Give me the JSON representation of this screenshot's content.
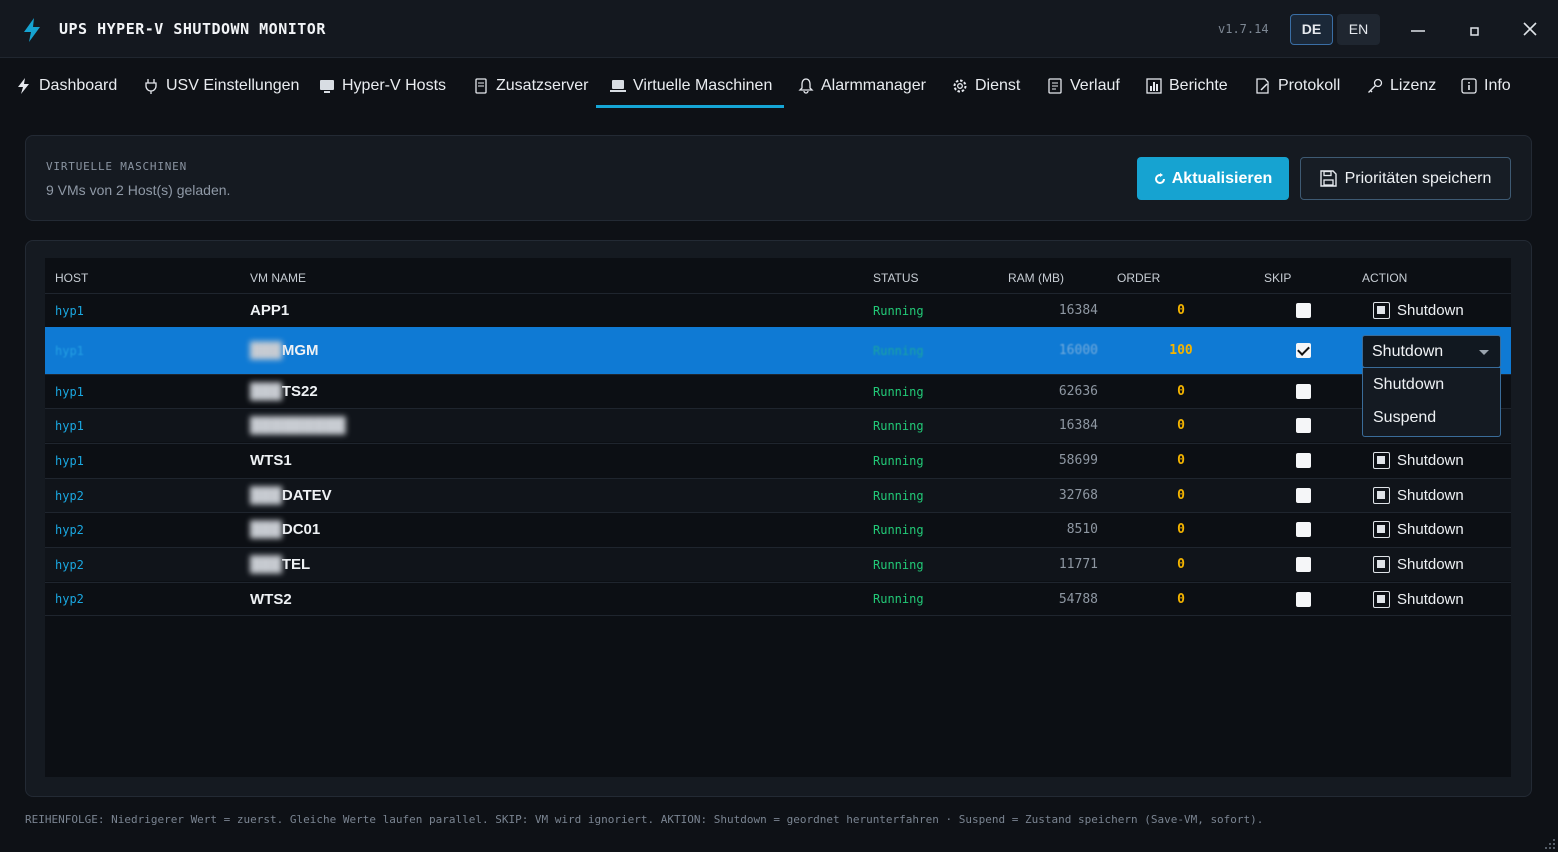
{
  "app": {
    "title": "UPS HYPER-V SHUTDOWN MONITOR",
    "version": "v1.7.14"
  },
  "lang": {
    "de": "DE",
    "en": "EN",
    "active": "DE"
  },
  "nav": {
    "dashboard": "Dashboard",
    "usv": "USV Einstellungen",
    "hyperv": "Hyper-V Hosts",
    "zusatz": "Zusatzserver",
    "vms": "Virtuelle Maschinen",
    "alarm": "Alarmmanager",
    "dienst": "Dienst",
    "verlauf": "Verlauf",
    "berichte": "Berichte",
    "protokoll": "Protokoll",
    "lizenz": "Lizenz",
    "info": "Info",
    "active": "Virtuelle Maschinen"
  },
  "header": {
    "label": "VIRTUELLE MASCHINEN",
    "subtitle": "9 VMs von 2 Host(s) geladen.",
    "refresh": "Aktualisieren",
    "save": "Prioritäten speichern"
  },
  "table": {
    "columns": {
      "host": "HOST",
      "vm": "VM NAME",
      "status": "STATUS",
      "ram": "RAM (MB)",
      "order": "ORDER",
      "skip": "SKIP",
      "action": "ACTION"
    },
    "rows": [
      {
        "host": "hyp1",
        "name_visible": "APP1",
        "status": "Running",
        "ram": "16384",
        "order": "0",
        "skip": false,
        "action": "Shutdown"
      },
      {
        "host": "hyp1",
        "name_visible": "MGM",
        "status": "Running",
        "ram": "16000",
        "order": "100",
        "skip": true,
        "action": "Shutdown",
        "selected": true
      },
      {
        "host": "hyp1",
        "name_visible": "TS22",
        "status": "Running",
        "ram": "62636",
        "order": "0",
        "skip": false,
        "action": ""
      },
      {
        "host": "hyp1",
        "name_visible": "",
        "status": "Running",
        "ram": "16384",
        "order": "0",
        "skip": false,
        "action": ""
      },
      {
        "host": "hyp1",
        "name_visible": "WTS1",
        "status": "Running",
        "ram": "58699",
        "order": "0",
        "skip": false,
        "action": "Shutdown"
      },
      {
        "host": "hyp2",
        "name_visible": "DATEV",
        "status": "Running",
        "ram": "32768",
        "order": "0",
        "skip": false,
        "action": "Shutdown"
      },
      {
        "host": "hyp2",
        "name_visible": "DC01",
        "status": "Running",
        "ram": "8510",
        "order": "0",
        "skip": false,
        "action": "Shutdown"
      },
      {
        "host": "hyp2",
        "name_visible": "TEL",
        "status": "Running",
        "ram": "11771",
        "order": "0",
        "skip": false,
        "action": "Shutdown"
      },
      {
        "host": "hyp2",
        "name_visible": "WTS2",
        "status": "Running",
        "ram": "54788",
        "order": "0",
        "skip": false,
        "action": "Shutdown"
      }
    ]
  },
  "dropdown": {
    "options": [
      "Shutdown",
      "Suspend"
    ]
  },
  "footer": "REIHENFOLGE: Niedrigerer Wert = zuerst. Gleiche Werte laufen parallel. SKIP: VM wird ignoriert. AKTION: Shutdown = geordnet herunterfahren · Suspend = Zustand speichern (Save-VM, sofort).",
  "colors": {
    "accent": "#16a3d1",
    "selected_row": "#0f7ad4",
    "running": "#22c977",
    "order": "#f4b400",
    "host": "#1aa7e0"
  }
}
